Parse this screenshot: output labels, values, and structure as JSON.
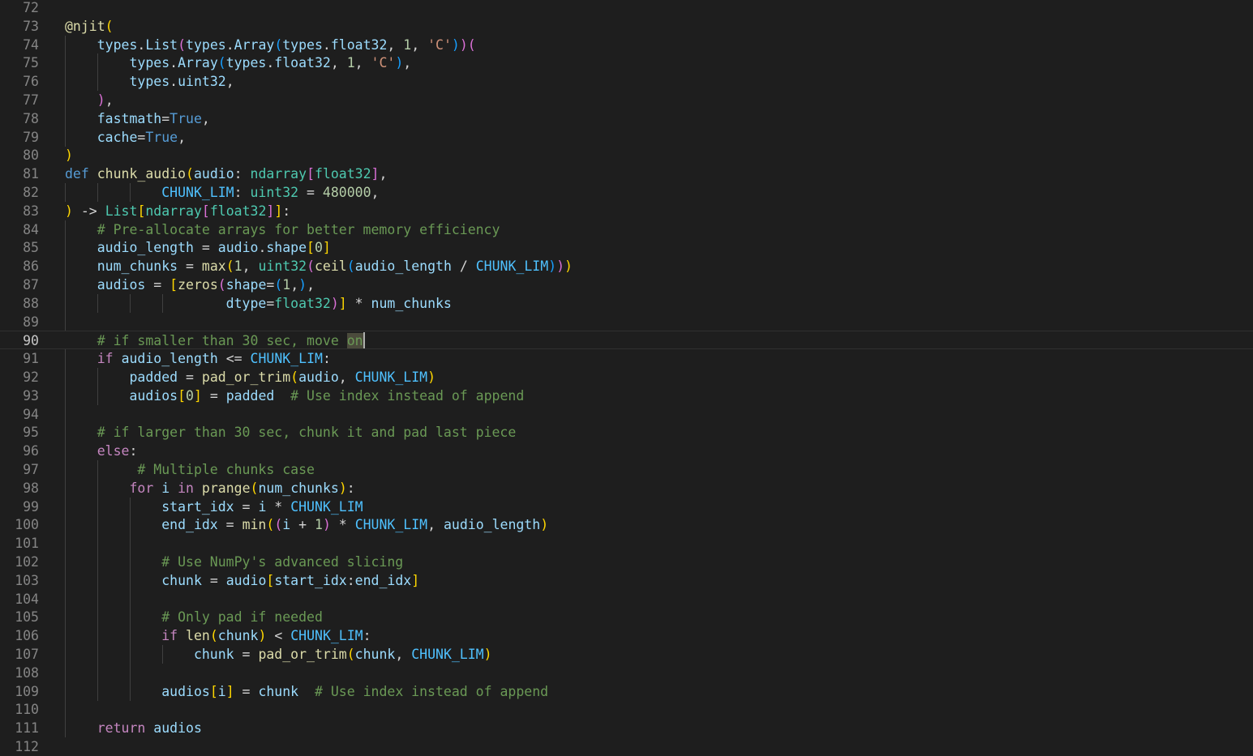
{
  "editor": {
    "active_line": 90,
    "cursor_line": 90,
    "selection_text": "on",
    "lines": [
      {
        "n": "72",
        "guides": [],
        "tokens": []
      },
      {
        "n": "73",
        "guides": [],
        "tokens": [
          [
            "@njit",
            "dec"
          ],
          [
            "(",
            "b1"
          ]
        ]
      },
      {
        "n": "74",
        "guides": [
          0
        ],
        "tokens": [
          [
            "    types",
            "var"
          ],
          [
            ".",
            "plain"
          ],
          [
            "List",
            "var"
          ],
          [
            "(",
            "b2"
          ],
          [
            "types",
            "var"
          ],
          [
            ".",
            "plain"
          ],
          [
            "Array",
            "var"
          ],
          [
            "(",
            "b3"
          ],
          [
            "types",
            "var"
          ],
          [
            ".",
            "plain"
          ],
          [
            "float32",
            "var"
          ],
          [
            ", ",
            "plain"
          ],
          [
            "1",
            "num"
          ],
          [
            ", ",
            "plain"
          ],
          [
            "'C'",
            "str"
          ],
          [
            ")",
            "b3"
          ],
          [
            ")",
            "b2"
          ],
          [
            "(",
            "b2"
          ]
        ]
      },
      {
        "n": "75",
        "guides": [
          0,
          1
        ],
        "tokens": [
          [
            "        types",
            "var"
          ],
          [
            ".",
            "plain"
          ],
          [
            "Array",
            "var"
          ],
          [
            "(",
            "b3"
          ],
          [
            "types",
            "var"
          ],
          [
            ".",
            "plain"
          ],
          [
            "float32",
            "var"
          ],
          [
            ", ",
            "plain"
          ],
          [
            "1",
            "num"
          ],
          [
            ", ",
            "plain"
          ],
          [
            "'C'",
            "str"
          ],
          [
            ")",
            "b3"
          ],
          [
            ",",
            "plain"
          ]
        ]
      },
      {
        "n": "76",
        "guides": [
          0,
          1
        ],
        "tokens": [
          [
            "        types",
            "var"
          ],
          [
            ".",
            "plain"
          ],
          [
            "uint32",
            "var"
          ],
          [
            ",",
            "plain"
          ]
        ]
      },
      {
        "n": "77",
        "guides": [
          0
        ],
        "tokens": [
          [
            "    ",
            "plain"
          ],
          [
            ")",
            "b2"
          ],
          [
            ",",
            "plain"
          ]
        ]
      },
      {
        "n": "78",
        "guides": [
          0
        ],
        "tokens": [
          [
            "    fastmath",
            "var"
          ],
          [
            "=",
            "plain"
          ],
          [
            "True",
            "kw"
          ],
          [
            ",",
            "plain"
          ]
        ]
      },
      {
        "n": "79",
        "guides": [
          0
        ],
        "tokens": [
          [
            "    cache",
            "var"
          ],
          [
            "=",
            "plain"
          ],
          [
            "True",
            "kw"
          ],
          [
            ",",
            "plain"
          ]
        ]
      },
      {
        "n": "80",
        "guides": [],
        "tokens": [
          [
            ")",
            "b1"
          ]
        ]
      },
      {
        "n": "81",
        "guides": [],
        "tokens": [
          [
            "def ",
            "kw"
          ],
          [
            "chunk_audio",
            "func"
          ],
          [
            "(",
            "b1"
          ],
          [
            "audio",
            "var"
          ],
          [
            ": ",
            "plain"
          ],
          [
            "ndarray",
            "type"
          ],
          [
            "[",
            "b2"
          ],
          [
            "float32",
            "type"
          ],
          [
            "]",
            "b2"
          ],
          [
            ",",
            "plain"
          ]
        ]
      },
      {
        "n": "82",
        "guides": [
          0,
          1,
          2
        ],
        "tokens": [
          [
            "            CHUNK_LIM",
            "const"
          ],
          [
            ": ",
            "plain"
          ],
          [
            "uint32",
            "type"
          ],
          [
            " = ",
            "plain"
          ],
          [
            "480000",
            "num"
          ],
          [
            ",",
            "plain"
          ]
        ]
      },
      {
        "n": "83",
        "guides": [],
        "tokens": [
          [
            ")",
            "b1"
          ],
          [
            " -> ",
            "plain"
          ],
          [
            "List",
            "type"
          ],
          [
            "[",
            "b1"
          ],
          [
            "ndarray",
            "type"
          ],
          [
            "[",
            "b2"
          ],
          [
            "float32",
            "type"
          ],
          [
            "]",
            "b2"
          ],
          [
            "]",
            "b1"
          ],
          [
            ":",
            "plain"
          ]
        ]
      },
      {
        "n": "84",
        "guides": [
          0
        ],
        "tokens": [
          [
            "    # Pre-allocate arrays for better memory efficiency",
            "cmt"
          ]
        ]
      },
      {
        "n": "85",
        "guides": [
          0
        ],
        "tokens": [
          [
            "    audio_length",
            "var"
          ],
          [
            " = ",
            "plain"
          ],
          [
            "audio",
            "var"
          ],
          [
            ".",
            "plain"
          ],
          [
            "shape",
            "var"
          ],
          [
            "[",
            "b1"
          ],
          [
            "0",
            "num"
          ],
          [
            "]",
            "b1"
          ]
        ]
      },
      {
        "n": "86",
        "guides": [
          0
        ],
        "tokens": [
          [
            "    num_chunks",
            "var"
          ],
          [
            " = ",
            "plain"
          ],
          [
            "max",
            "func"
          ],
          [
            "(",
            "b1"
          ],
          [
            "1",
            "num"
          ],
          [
            ", ",
            "plain"
          ],
          [
            "uint32",
            "type"
          ],
          [
            "(",
            "b2"
          ],
          [
            "ceil",
            "func"
          ],
          [
            "(",
            "b3"
          ],
          [
            "audio_length",
            "var"
          ],
          [
            " / ",
            "plain"
          ],
          [
            "CHUNK_LIM",
            "const"
          ],
          [
            ")",
            "b3"
          ],
          [
            ")",
            "b2"
          ],
          [
            ")",
            "b1"
          ]
        ]
      },
      {
        "n": "87",
        "guides": [
          0
        ],
        "tokens": [
          [
            "    audios",
            "var"
          ],
          [
            " = ",
            "plain"
          ],
          [
            "[",
            "b1"
          ],
          [
            "zeros",
            "func"
          ],
          [
            "(",
            "b2"
          ],
          [
            "shape",
            "var"
          ],
          [
            "=",
            "plain"
          ],
          [
            "(",
            "b3"
          ],
          [
            "1",
            "num"
          ],
          [
            ",",
            "plain"
          ],
          [
            ")",
            "b3"
          ],
          [
            ",",
            "plain"
          ]
        ]
      },
      {
        "n": "88",
        "guides": [
          0,
          1,
          2,
          3
        ],
        "tokens": [
          [
            "                    dtype",
            "var"
          ],
          [
            "=",
            "plain"
          ],
          [
            "float32",
            "type"
          ],
          [
            ")",
            "b2"
          ],
          [
            "]",
            "b1"
          ],
          [
            " * ",
            "plain"
          ],
          [
            "num_chunks",
            "var"
          ]
        ]
      },
      {
        "n": "89",
        "guides": [
          0
        ],
        "tokens": []
      },
      {
        "n": "90",
        "guides": [],
        "tokens": [
          [
            "    # if smaller than 30 sec, move ",
            "cmt"
          ],
          [
            "on",
            "cmt-sel"
          ]
        ]
      },
      {
        "n": "91",
        "guides": [
          0
        ],
        "tokens": [
          [
            "    ",
            "plain"
          ],
          [
            "if ",
            "ctrl"
          ],
          [
            "audio_length",
            "var"
          ],
          [
            " <= ",
            "plain"
          ],
          [
            "CHUNK_LIM",
            "const"
          ],
          [
            ":",
            "plain"
          ]
        ]
      },
      {
        "n": "92",
        "guides": [
          0,
          1
        ],
        "tokens": [
          [
            "        padded",
            "var"
          ],
          [
            " = ",
            "plain"
          ],
          [
            "pad_or_trim",
            "func"
          ],
          [
            "(",
            "b1"
          ],
          [
            "audio",
            "var"
          ],
          [
            ", ",
            "plain"
          ],
          [
            "CHUNK_LIM",
            "const"
          ],
          [
            ")",
            "b1"
          ]
        ]
      },
      {
        "n": "93",
        "guides": [
          0,
          1
        ],
        "tokens": [
          [
            "        audios",
            "var"
          ],
          [
            "[",
            "b1"
          ],
          [
            "0",
            "num"
          ],
          [
            "]",
            "b1"
          ],
          [
            " = ",
            "plain"
          ],
          [
            "padded",
            "var"
          ],
          [
            "  # Use index instead of append",
            "cmt"
          ]
        ]
      },
      {
        "n": "94",
        "guides": [
          0
        ],
        "tokens": []
      },
      {
        "n": "95",
        "guides": [
          0
        ],
        "tokens": [
          [
            "    # if larger than 30 sec, chunk it and pad last piece",
            "cmt"
          ]
        ]
      },
      {
        "n": "96",
        "guides": [
          0
        ],
        "tokens": [
          [
            "    ",
            "plain"
          ],
          [
            "else",
            "ctrl"
          ],
          [
            ":",
            "plain"
          ]
        ]
      },
      {
        "n": "97",
        "guides": [
          0,
          1
        ],
        "tokens": [
          [
            "         # Multiple chunks case",
            "cmt"
          ]
        ]
      },
      {
        "n": "98",
        "guides": [
          0,
          1
        ],
        "tokens": [
          [
            "        ",
            "plain"
          ],
          [
            "for ",
            "ctrl"
          ],
          [
            "i",
            "var"
          ],
          [
            " in ",
            "ctrl"
          ],
          [
            "prange",
            "func"
          ],
          [
            "(",
            "b1"
          ],
          [
            "num_chunks",
            "var"
          ],
          [
            ")",
            "b1"
          ],
          [
            ":",
            "plain"
          ]
        ]
      },
      {
        "n": "99",
        "guides": [
          0,
          1,
          2
        ],
        "tokens": [
          [
            "            start_idx",
            "var"
          ],
          [
            " = ",
            "plain"
          ],
          [
            "i",
            "var"
          ],
          [
            " * ",
            "plain"
          ],
          [
            "CHUNK_LIM",
            "const"
          ]
        ]
      },
      {
        "n": "100",
        "guides": [
          0,
          1,
          2
        ],
        "tokens": [
          [
            "            end_idx",
            "var"
          ],
          [
            " = ",
            "plain"
          ],
          [
            "min",
            "func"
          ],
          [
            "(",
            "b1"
          ],
          [
            "(",
            "b2"
          ],
          [
            "i",
            "var"
          ],
          [
            " + ",
            "plain"
          ],
          [
            "1",
            "num"
          ],
          [
            ")",
            "b2"
          ],
          [
            " * ",
            "plain"
          ],
          [
            "CHUNK_LIM",
            "const"
          ],
          [
            ", ",
            "plain"
          ],
          [
            "audio_length",
            "var"
          ],
          [
            ")",
            "b1"
          ]
        ]
      },
      {
        "n": "101",
        "guides": [
          0,
          1,
          2
        ],
        "tokens": []
      },
      {
        "n": "102",
        "guides": [
          0,
          1,
          2
        ],
        "tokens": [
          [
            "            # Use NumPy's advanced slicing",
            "cmt"
          ]
        ]
      },
      {
        "n": "103",
        "guides": [
          0,
          1,
          2
        ],
        "tokens": [
          [
            "            chunk",
            "var"
          ],
          [
            " = ",
            "plain"
          ],
          [
            "audio",
            "var"
          ],
          [
            "[",
            "b1"
          ],
          [
            "start_idx",
            "var"
          ],
          [
            ":",
            "plain"
          ],
          [
            "end_idx",
            "var"
          ],
          [
            "]",
            "b1"
          ]
        ]
      },
      {
        "n": "104",
        "guides": [
          0,
          1,
          2
        ],
        "tokens": []
      },
      {
        "n": "105",
        "guides": [
          0,
          1,
          2
        ],
        "tokens": [
          [
            "            # Only pad if needed",
            "cmt"
          ]
        ]
      },
      {
        "n": "106",
        "guides": [
          0,
          1,
          2
        ],
        "tokens": [
          [
            "            ",
            "plain"
          ],
          [
            "if ",
            "ctrl"
          ],
          [
            "len",
            "func"
          ],
          [
            "(",
            "b1"
          ],
          [
            "chunk",
            "var"
          ],
          [
            ")",
            "b1"
          ],
          [
            " < ",
            "plain"
          ],
          [
            "CHUNK_LIM",
            "const"
          ],
          [
            ":",
            "plain"
          ]
        ]
      },
      {
        "n": "107",
        "guides": [
          0,
          1,
          2,
          3
        ],
        "tokens": [
          [
            "                chunk",
            "var"
          ],
          [
            " = ",
            "plain"
          ],
          [
            "pad_or_trim",
            "func"
          ],
          [
            "(",
            "b1"
          ],
          [
            "chunk",
            "var"
          ],
          [
            ", ",
            "plain"
          ],
          [
            "CHUNK_LIM",
            "const"
          ],
          [
            ")",
            "b1"
          ]
        ]
      },
      {
        "n": "108",
        "guides": [
          0,
          1,
          2
        ],
        "tokens": []
      },
      {
        "n": "109",
        "guides": [
          0,
          1,
          2
        ],
        "tokens": [
          [
            "            audios",
            "var"
          ],
          [
            "[",
            "b1"
          ],
          [
            "i",
            "var"
          ],
          [
            "]",
            "b1"
          ],
          [
            " = ",
            "plain"
          ],
          [
            "chunk",
            "var"
          ],
          [
            "  # Use index instead of append",
            "cmt"
          ]
        ]
      },
      {
        "n": "110",
        "guides": [
          0
        ],
        "tokens": []
      },
      {
        "n": "111",
        "guides": [
          0
        ],
        "tokens": [
          [
            "    ",
            "plain"
          ],
          [
            "return ",
            "ctrl"
          ],
          [
            "audios",
            "var"
          ]
        ]
      },
      {
        "n": "112",
        "guides": [],
        "tokens": []
      }
    ]
  }
}
